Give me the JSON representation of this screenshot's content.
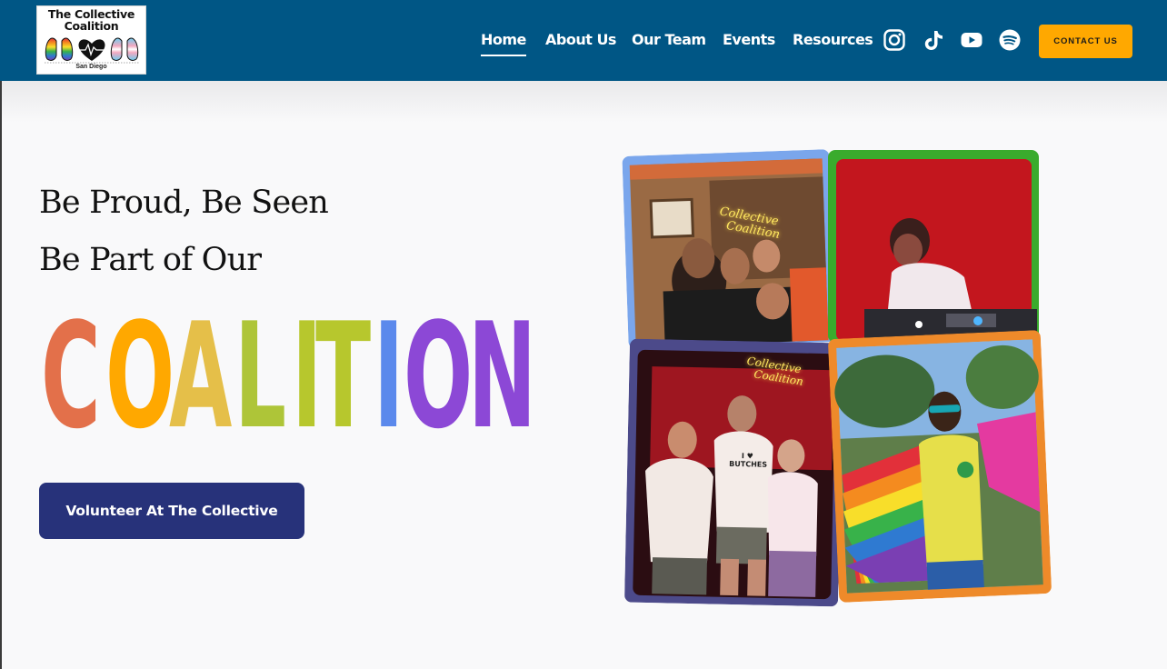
{
  "header": {
    "logo": {
      "line1": "The Collective",
      "line2": "Coalition",
      "subtitle": "San Diego"
    },
    "nav": [
      {
        "label": "Home",
        "active": true
      },
      {
        "label": "About Us",
        "active": false
      },
      {
        "label": "Our Team",
        "active": false
      },
      {
        "label": "Events",
        "active": false
      },
      {
        "label": "Resources",
        "active": false
      }
    ],
    "social_icons": [
      "instagram-icon",
      "tiktok-icon",
      "youtube-icon",
      "spotify-icon"
    ],
    "contact_label": "CONTACT US"
  },
  "hero": {
    "line1": "Be Proud, Be Seen",
    "line2": "Be Part of Our",
    "big_word_letters": [
      {
        "char": "C",
        "color": "#e3704a"
      },
      {
        "char": "O",
        "color": "#ffa800"
      },
      {
        "char": "A",
        "color": "#e5bf49"
      },
      {
        "char": "L",
        "color": "#aec538"
      },
      {
        "char": "I",
        "color": "#b7c72d"
      },
      {
        "char": "T",
        "color": "#b7c72d"
      },
      {
        "char": "I",
        "color": "#5b89ec"
      },
      {
        "char": "O",
        "color": "#8c48d6"
      },
      {
        "char": "N",
        "color": "#8c48d6"
      }
    ],
    "volunteer_label": "Volunteer At The Collective",
    "neon_sign": {
      "line1": "Collective",
      "line2": "Coalition"
    },
    "shirt_text": "I ♥ BUTCHES"
  },
  "colors": {
    "header_bg": "#005685",
    "contact_bg": "#ffa800",
    "volunteer_bg": "#27327a",
    "frame_blue": "#7aa6ec",
    "frame_green": "#3aab2d",
    "frame_purple": "#4c4a8a",
    "frame_orange": "#ee8a2a"
  }
}
